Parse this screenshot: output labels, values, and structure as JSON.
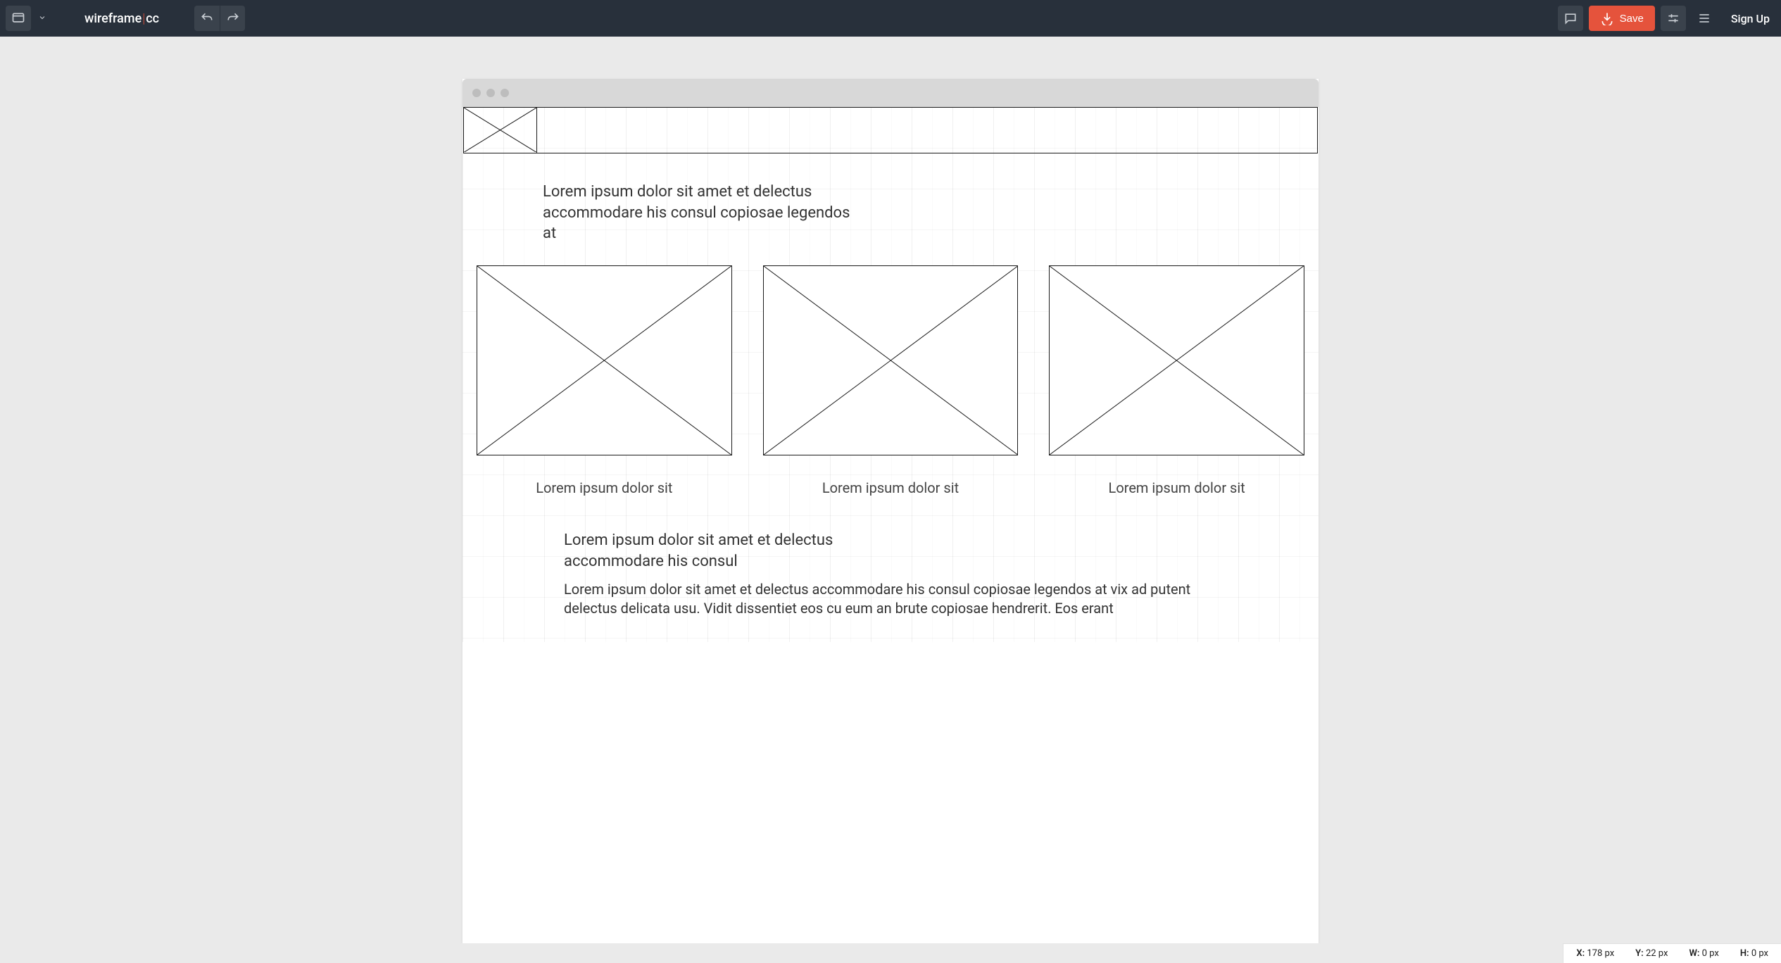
{
  "toolbar": {
    "logo_left": "wireframe",
    "logo_right": "cc",
    "save_label": "Save",
    "signup_label": "Sign Up"
  },
  "wireframe": {
    "hero_text": "Lorem ipsum dolor sit amet et delectus accommodare his consul copiosae legendos at",
    "cards": [
      {
        "caption": "Lorem ipsum dolor sit"
      },
      {
        "caption": "Lorem ipsum dolor sit"
      },
      {
        "caption": "Lorem ipsum dolor sit"
      }
    ],
    "section_heading": "Lorem ipsum dolor sit amet et delectus accommodare his consul",
    "section_body": "Lorem ipsum dolor sit amet et delectus accommodare his consul copiosae legendos at vix ad putent delectus delicata usu. Vidit dissentiet eos cu eum an brute copiosae hendrerit. Eos erant"
  },
  "status": {
    "x_label": "X:",
    "x_value": "178 px",
    "y_label": "Y:",
    "y_value": "22 px",
    "w_label": "W:",
    "w_value": "0 px",
    "h_label": "H:",
    "h_value": "0 px"
  }
}
